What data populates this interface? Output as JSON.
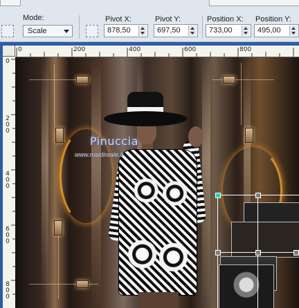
{
  "toolbar": {
    "mode_label": "Mode:",
    "mode_value": "Scale",
    "pivot_x_label": "Pivot X:",
    "pivot_x_value": "878,50",
    "pivot_y_label": "Pivot Y:",
    "pivot_y_value": "697,50",
    "position_x_label": "Position X:",
    "position_x_value": "733,00",
    "position_y_label": "Position Y:",
    "position_y_value": "495,00"
  },
  "ruler": {
    "h_labels": [
      "0",
      "200",
      "400",
      "600",
      "800"
    ],
    "v_labels": [
      "0",
      "2\n0\n0",
      "4\n0\n0",
      "6\n0\n0",
      "8\n0\n0"
    ]
  },
  "image": {
    "watermark": "Pinuccia",
    "watermark_url": "www.maidireale.it"
  },
  "colors": {
    "window_frame": "#2f5ba6",
    "pivot_handle": "#19d6c9"
  }
}
